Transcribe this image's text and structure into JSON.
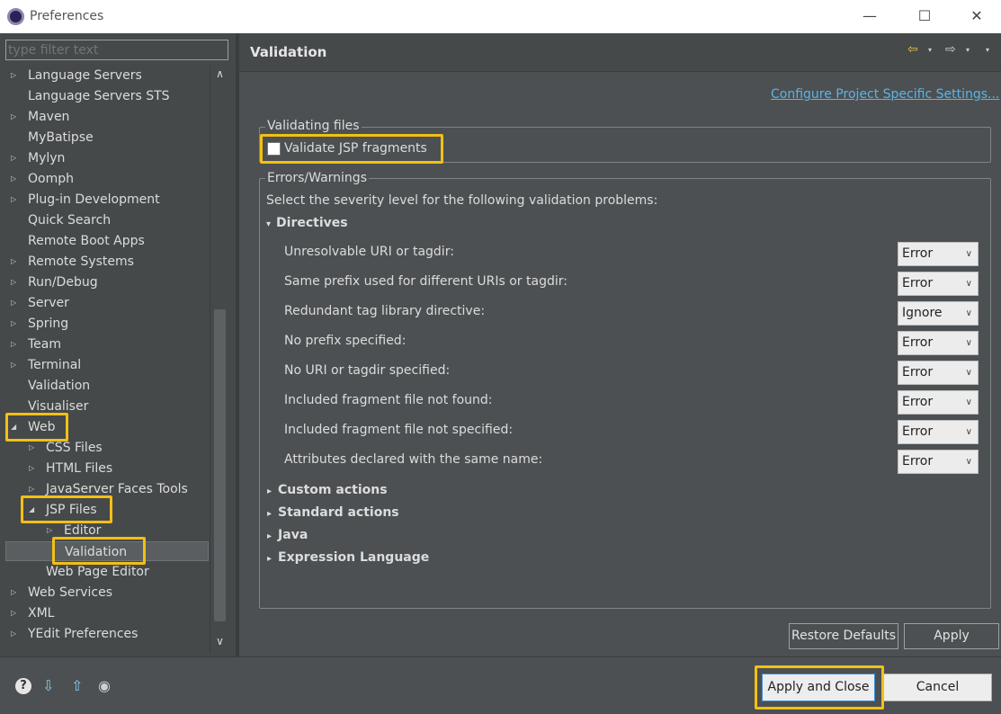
{
  "window": {
    "title": "Preferences",
    "minimize": "—",
    "maximize": "☐",
    "close": "✕"
  },
  "filter": {
    "placeholder": "type filter text"
  },
  "tree": [
    {
      "label": "Language Servers",
      "twisty": "▷",
      "selected": false
    },
    {
      "label": "Language Servers STS",
      "twisty": "",
      "selected": false
    },
    {
      "label": "Maven",
      "twisty": "▷",
      "selected": false
    },
    {
      "label": "MyBatipse",
      "twisty": "",
      "selected": false
    },
    {
      "label": "Mylyn",
      "twisty": "▷",
      "selected": false
    },
    {
      "label": "Oomph",
      "twisty": "▷",
      "selected": false
    },
    {
      "label": "Plug-in Development",
      "twisty": "▷",
      "selected": false
    },
    {
      "label": "Quick Search",
      "twisty": "",
      "selected": false
    },
    {
      "label": "Remote Boot Apps",
      "twisty": "",
      "selected": false
    },
    {
      "label": "Remote Systems",
      "twisty": "▷",
      "selected": false
    },
    {
      "label": "Run/Debug",
      "twisty": "▷",
      "selected": false
    },
    {
      "label": "Server",
      "twisty": "▷",
      "selected": false
    },
    {
      "label": "Spring",
      "twisty": "▷",
      "selected": false
    },
    {
      "label": "Team",
      "twisty": "▷",
      "selected": false
    },
    {
      "label": "Terminal",
      "twisty": "▷",
      "selected": false
    },
    {
      "label": "Validation",
      "twisty": "",
      "selected": false
    },
    {
      "label": "Visualiser",
      "twisty": "",
      "selected": false
    },
    {
      "label": "Web",
      "twisty": "◢",
      "selected": false
    },
    {
      "label": "CSS Files",
      "twisty": "▷",
      "selected": false
    },
    {
      "label": "HTML Files",
      "twisty": "▷",
      "selected": false
    },
    {
      "label": "JavaServer Faces Tools",
      "twisty": "▷",
      "selected": false
    },
    {
      "label": "JSP Files",
      "twisty": "◢",
      "selected": false
    },
    {
      "label": "Editor",
      "twisty": "▷",
      "selected": false
    },
    {
      "label": "Validation",
      "twisty": "",
      "selected": true
    },
    {
      "label": "Web Page Editor",
      "twisty": "",
      "selected": false
    },
    {
      "label": "Web Services",
      "twisty": "▷",
      "selected": false
    },
    {
      "label": "XML",
      "twisty": "▷",
      "selected": false
    },
    {
      "label": "YEdit Preferences",
      "twisty": "▷",
      "selected": false
    }
  ],
  "scroll": {
    "up": "∧",
    "down": "∨"
  },
  "page": {
    "title": "Validation",
    "configure_link": "Configure Project Specific Settings...",
    "validating_files": {
      "legend": "Validating files",
      "checkbox_label": "Validate JSP fragments",
      "checked": false
    },
    "errors_warnings": {
      "legend": "Errors/Warnings",
      "description": "Select the severity level for the following validation problems:",
      "directives": {
        "label": "Directives",
        "expanded": true,
        "twisty": "▾",
        "rows": [
          {
            "label": "Unresolvable URI or tagdir:",
            "value": "Error"
          },
          {
            "label": "Same prefix used for different URIs or tagdir:",
            "value": "Error"
          },
          {
            "label": "Redundant tag library directive:",
            "value": "Ignore"
          },
          {
            "label": "No prefix specified:",
            "value": "Error"
          },
          {
            "label": "No URI or tagdir specified:",
            "value": "Error"
          },
          {
            "label": "Included fragment file not found:",
            "value": "Error"
          },
          {
            "label": "Included fragment file not specified:",
            "value": "Error"
          },
          {
            "label": "Attributes declared with the same name:",
            "value": "Error"
          }
        ]
      },
      "collapsed_sections": [
        {
          "label": "Custom actions",
          "twisty": "▸"
        },
        {
          "label": "Standard actions",
          "twisty": "▸"
        },
        {
          "label": "Java",
          "twisty": "▸"
        },
        {
          "label": "Expression Language",
          "twisty": "▸"
        }
      ]
    },
    "restore_defaults": "Restore Defaults",
    "apply": "Apply"
  },
  "nav": {
    "back": "⇦",
    "forward": "⇨",
    "menu": "▾"
  },
  "footer": {
    "help_icon": "?",
    "import_icon": "⇩",
    "export_icon": "⇧",
    "oomph_icon": "◉",
    "apply_and_close": "Apply and Close",
    "cancel": "Cancel"
  },
  "colors": {
    "highlight": "#f2c015",
    "link": "#5ab4e8",
    "background": "#4c5052"
  }
}
